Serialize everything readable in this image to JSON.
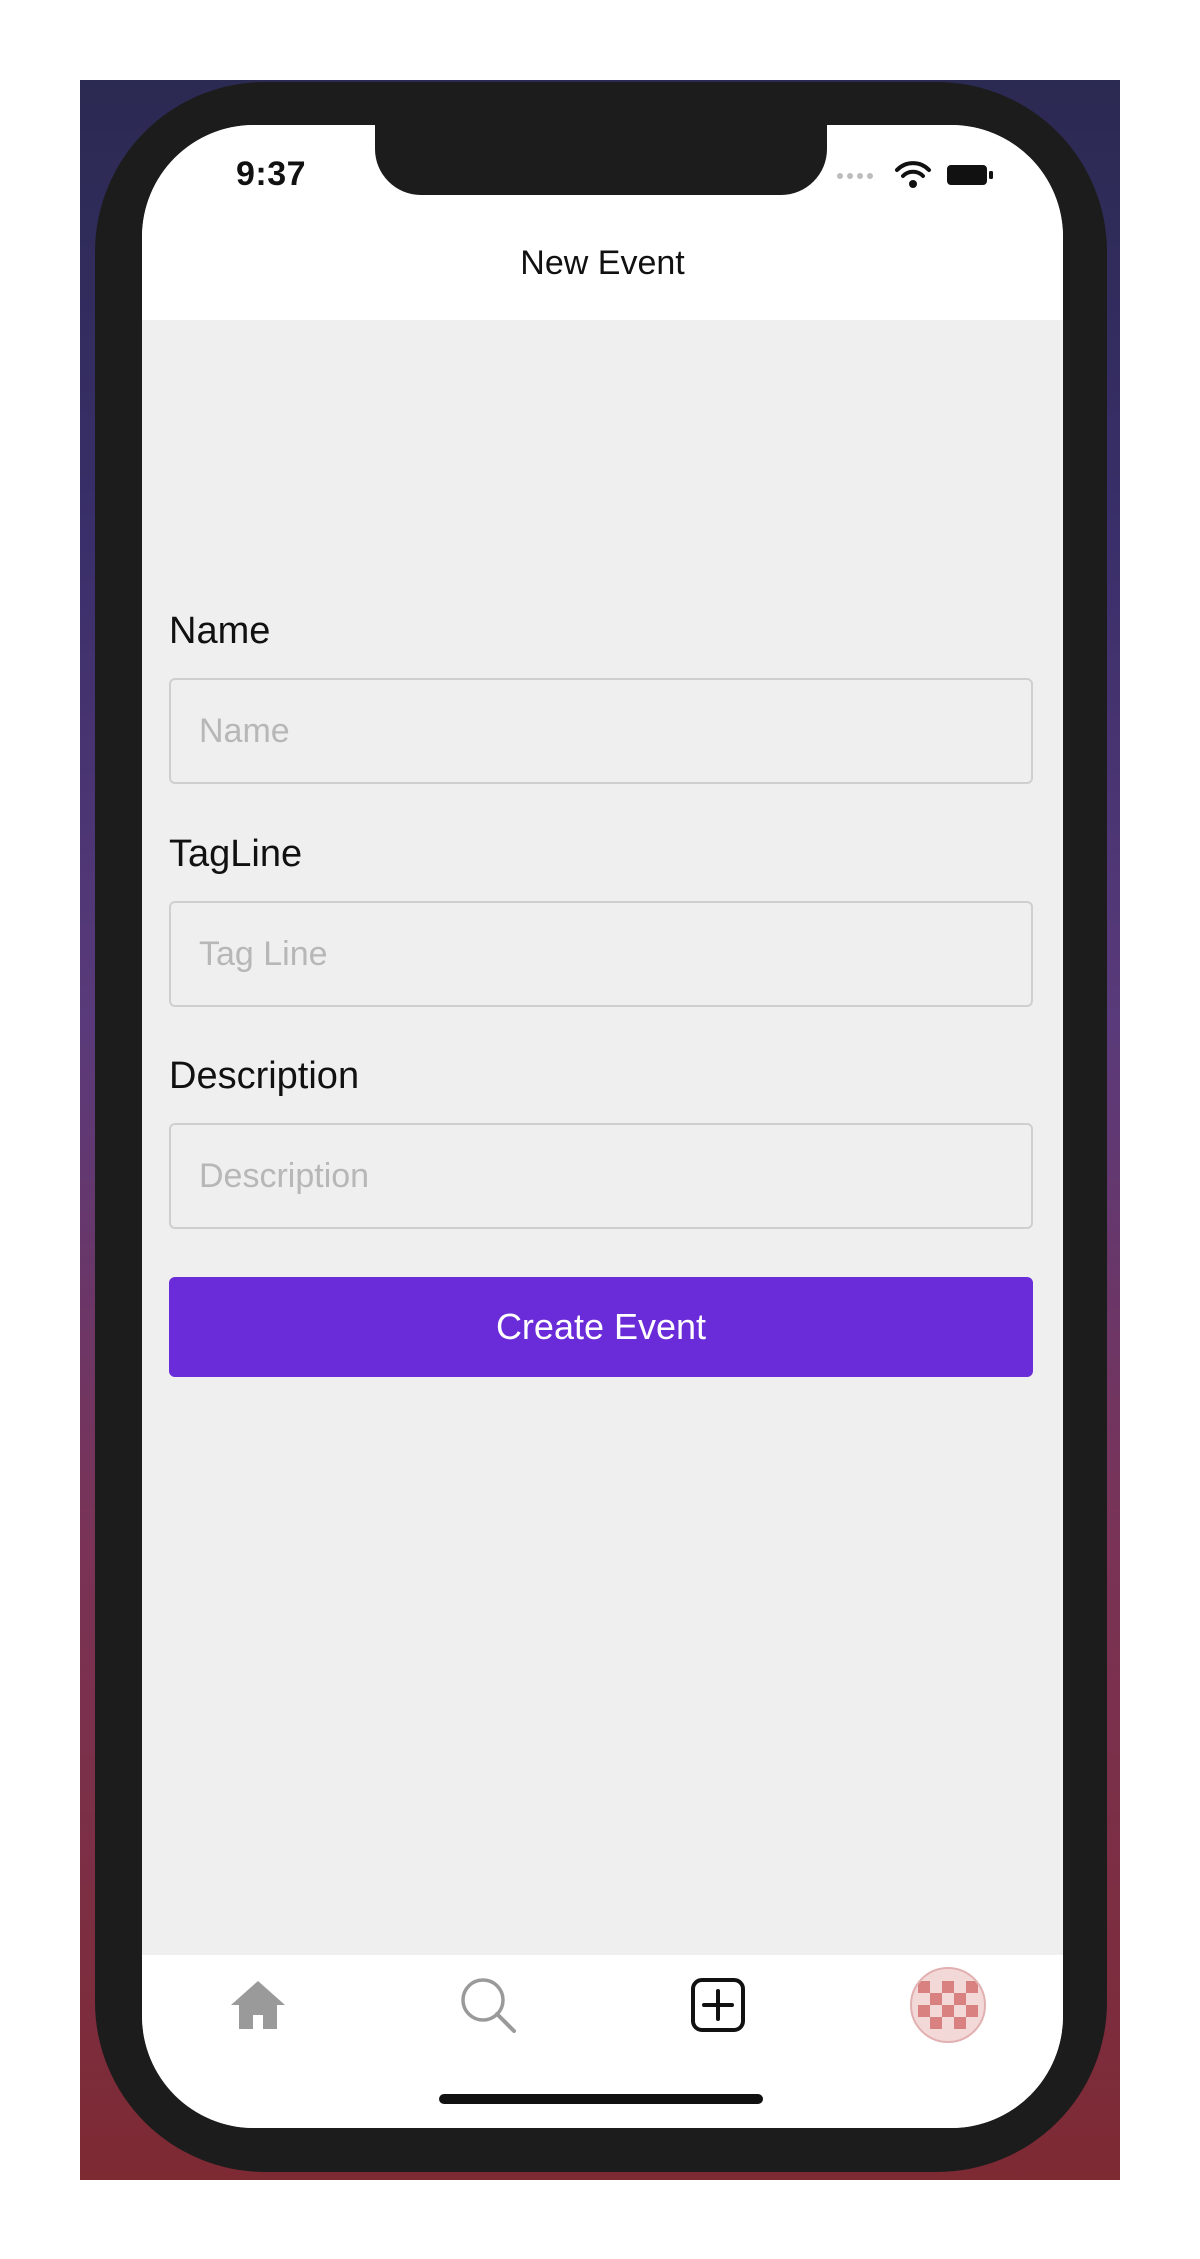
{
  "status_bar": {
    "time": "9:37"
  },
  "header": {
    "title": "New Event"
  },
  "form": {
    "name": {
      "label": "Name",
      "placeholder": "Name",
      "value": ""
    },
    "tagline": {
      "label": "TagLine",
      "placeholder": "Tag Line",
      "value": ""
    },
    "description": {
      "label": "Description",
      "placeholder": "Description",
      "value": ""
    },
    "submit_label": "Create Event"
  },
  "tab_bar": {
    "items": [
      {
        "icon": "home-icon",
        "active": false
      },
      {
        "icon": "search-icon",
        "active": false
      },
      {
        "icon": "add-square-icon",
        "active": true
      },
      {
        "icon": "profile-avatar",
        "active": false
      }
    ]
  },
  "colors": {
    "accent": "#6a2bd9",
    "background": "#efefef",
    "inactive_icon": "#9a9a9a"
  }
}
